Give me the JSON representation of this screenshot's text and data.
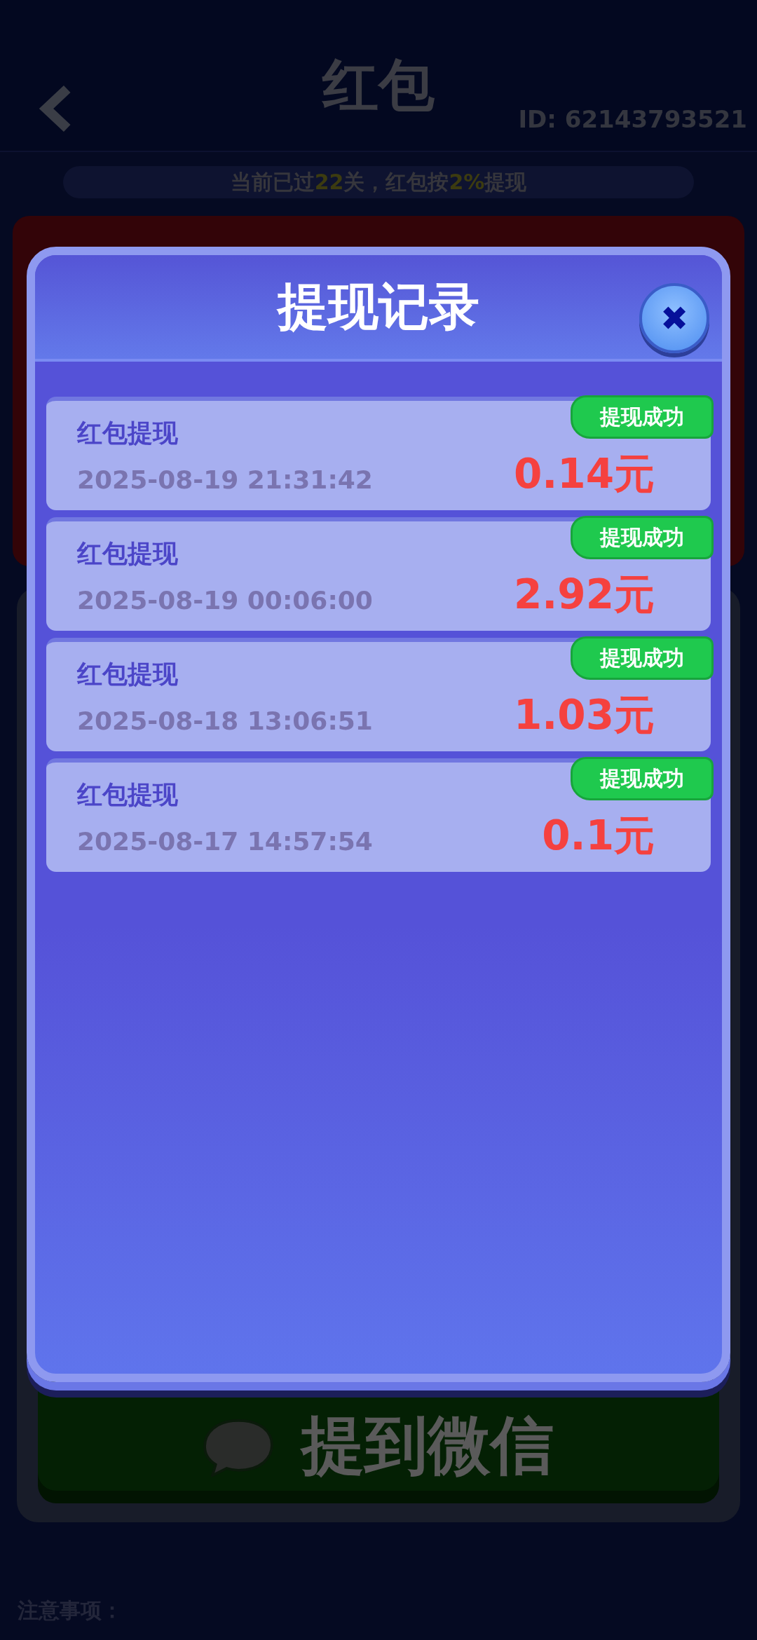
{
  "header": {
    "title": "红包",
    "user_id": "ID: 62143793521"
  },
  "progress_banner": "当前已过**22**关，红包按**2%**提现",
  "withdraw_button": {
    "label": "提到微信"
  },
  "notes_heading": "注意事项：",
  "dialog": {
    "title": "提现记录",
    "close_label": "✖",
    "records": [
      {
        "title": "红包提现",
        "time": "2025-08-19 21:31:42",
        "amount": "0.14元",
        "status": "提现成功"
      },
      {
        "title": "红包提现",
        "time": "2025-08-19 00:06:00",
        "amount": "2.92元",
        "status": "提现成功"
      },
      {
        "title": "红包提现",
        "time": "2025-08-18 13:06:51",
        "amount": "1.03元",
        "status": "提现成功"
      },
      {
        "title": "红包提现",
        "time": "2025-08-17 14:57:54",
        "amount": "0.1元",
        "status": "提现成功"
      }
    ]
  }
}
